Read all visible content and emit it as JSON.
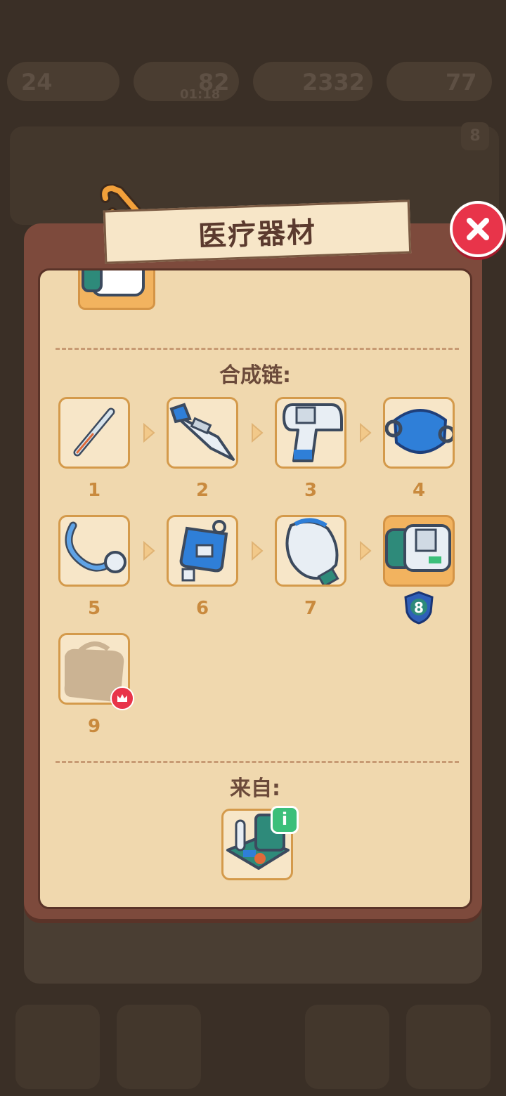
{
  "background": {
    "top_values": [
      "24",
      "82",
      "01:18",
      "2332",
      "77"
    ],
    "card_badge": "8"
  },
  "dialog": {
    "title": "医疗器材",
    "close_label": "close",
    "chain_title": "合成链:",
    "source_title": "来自:"
  },
  "chain": [
    {
      "level": "1",
      "name": "thermometer-icon"
    },
    {
      "level": "2",
      "name": "digital-thermometer-icon"
    },
    {
      "level": "3",
      "name": "infrared-thermometer-icon"
    },
    {
      "level": "4",
      "name": "face-mask-icon"
    },
    {
      "level": "5",
      "name": "stethoscope-icon"
    },
    {
      "level": "6",
      "name": "iv-bag-icon"
    },
    {
      "level": "7",
      "name": "oxygen-bottle-icon"
    },
    {
      "level": "8",
      "name": "blood-pressure-monitor-icon",
      "current": true
    },
    {
      "level": "9",
      "name": "locked-bag-icon",
      "locked": true
    }
  ],
  "current_badge": "8",
  "source": {
    "name": "medical-kit-icon",
    "info": "i"
  },
  "colors": {
    "dialog": "#7d4a3c",
    "panel": "#f0d8ae",
    "slot": "#f7e6c8",
    "slot_border": "#d49a4b",
    "highlight": "#f2b35f",
    "number": "#c98a3e",
    "close": "#e8344a",
    "info": "#3bbf7a",
    "shield": "#2f5fb8"
  }
}
